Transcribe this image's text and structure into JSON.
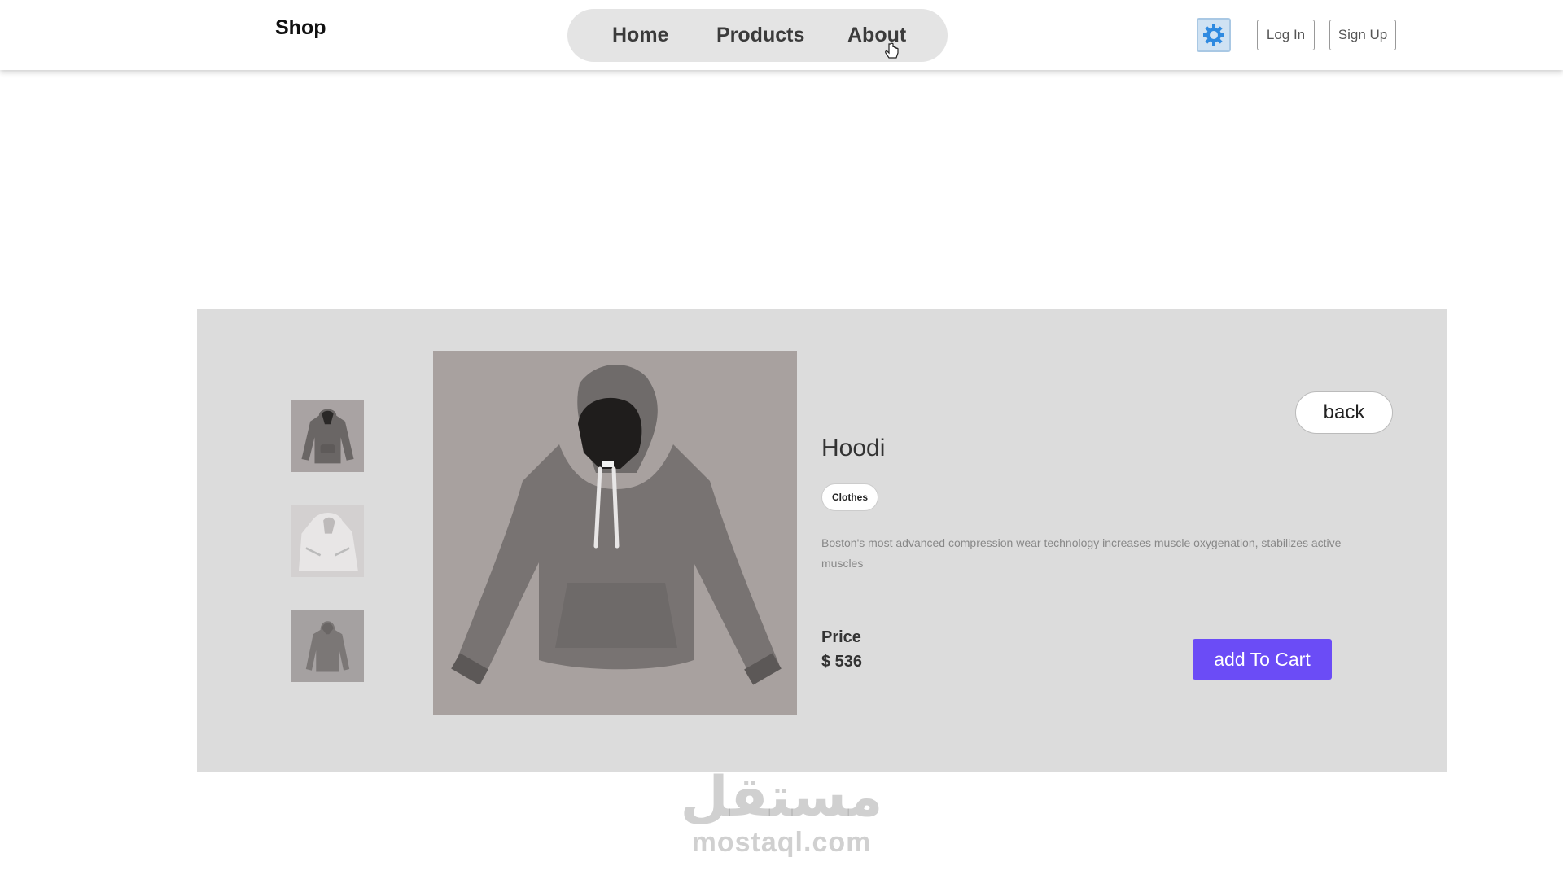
{
  "header": {
    "brand": "Shop",
    "nav": [
      {
        "label": "Home"
      },
      {
        "label": "Products"
      },
      {
        "label": "About"
      }
    ],
    "settings_icon": "gear-icon",
    "login_label": "Log In",
    "signup_label": "Sign Up"
  },
  "product": {
    "name": "Hoodi",
    "category": "Clothes",
    "description": "Boston's most advanced compression wear technology increases muscle oxygenation, stabilizes active muscles",
    "price_label": "Price",
    "price": "$ 536",
    "back_label": "back",
    "cart_label": "add To Cart",
    "thumbnails": [
      "hoodie-front",
      "hoodie-light",
      "hoodie-back"
    ]
  },
  "watermark": {
    "glyph": "مستقل",
    "text": "mostaql.com"
  },
  "colors": {
    "accent": "#6b4cf6",
    "card_bg": "#dcdcdc",
    "nav_bg": "#e4e4e4",
    "settings_icon": "#2f8ae0"
  }
}
